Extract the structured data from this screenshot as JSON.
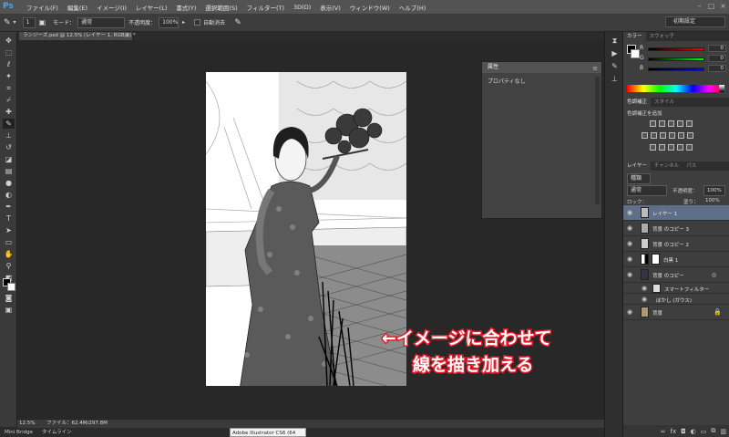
{
  "app": {
    "logo": "Ps",
    "workspace": "初期設定"
  },
  "menu": [
    "ファイル(F)",
    "編集(E)",
    "イメージ(I)",
    "レイヤー(L)",
    "書式(Y)",
    "選択範囲(S)",
    "フィルター(T)",
    "3D(D)",
    "表示(V)",
    "ウィンドウ(W)",
    "ヘルプ(H)"
  ],
  "options": {
    "size": "1",
    "mode_label": "モード：",
    "mode_value": "通常",
    "opacity_label": "不透明度：",
    "opacity_value": "100%",
    "auto_erase": "自動消去"
  },
  "document": {
    "tab": "ランジーズ.psd @ 12.5% (レイヤー 1, RGB/8) *",
    "close": "×"
  },
  "annotation": {
    "line1": "←イメージに合わせて",
    "line2": "線を描き加える"
  },
  "properties": {
    "title": "属性",
    "body": "プロパティなし"
  },
  "status": {
    "zoom": "12.5%",
    "file": "ファイル：62.4M/297.8M"
  },
  "bottom_tabs": [
    "Mini Bridge",
    "タイムライン"
  ],
  "tooltip": "Adobe Illustrator CS6 (64 Bit)",
  "color_panel": {
    "tabs": [
      "カラー",
      "スウォッチ"
    ],
    "sliders": [
      {
        "label": "R",
        "value": "0",
        "color": "#c02020"
      },
      {
        "label": "G",
        "value": "0",
        "color": "#20a020"
      },
      {
        "label": "B",
        "value": "0",
        "color": "#2030c0"
      }
    ]
  },
  "adjust_panel": {
    "tabs": [
      "色調補正",
      "スタイル"
    ],
    "hint": "色調補正を追加"
  },
  "layers_panel": {
    "tabs": [
      "レイヤー",
      "チャンネル",
      "パス"
    ],
    "kind": "種類",
    "blend": "通常",
    "opacity_label": "不透明度：",
    "opacity": "100%",
    "lock_label": "ロック：",
    "fill_label": "塗り：",
    "fill": "100%",
    "layers": [
      {
        "name": "レイヤー 1",
        "selected": true
      },
      {
        "name": "背景 のコピー 3"
      },
      {
        "name": "背景 のコピー 2"
      },
      {
        "name": "白黒 1"
      },
      {
        "name": "背景 のコピー",
        "fx": "◎"
      },
      {
        "name": "スマートフィルター",
        "sub": true
      },
      {
        "name": "ぼかし (ガウス)",
        "sub": true
      },
      {
        "name": "背景",
        "lock": "🔒"
      }
    ]
  }
}
